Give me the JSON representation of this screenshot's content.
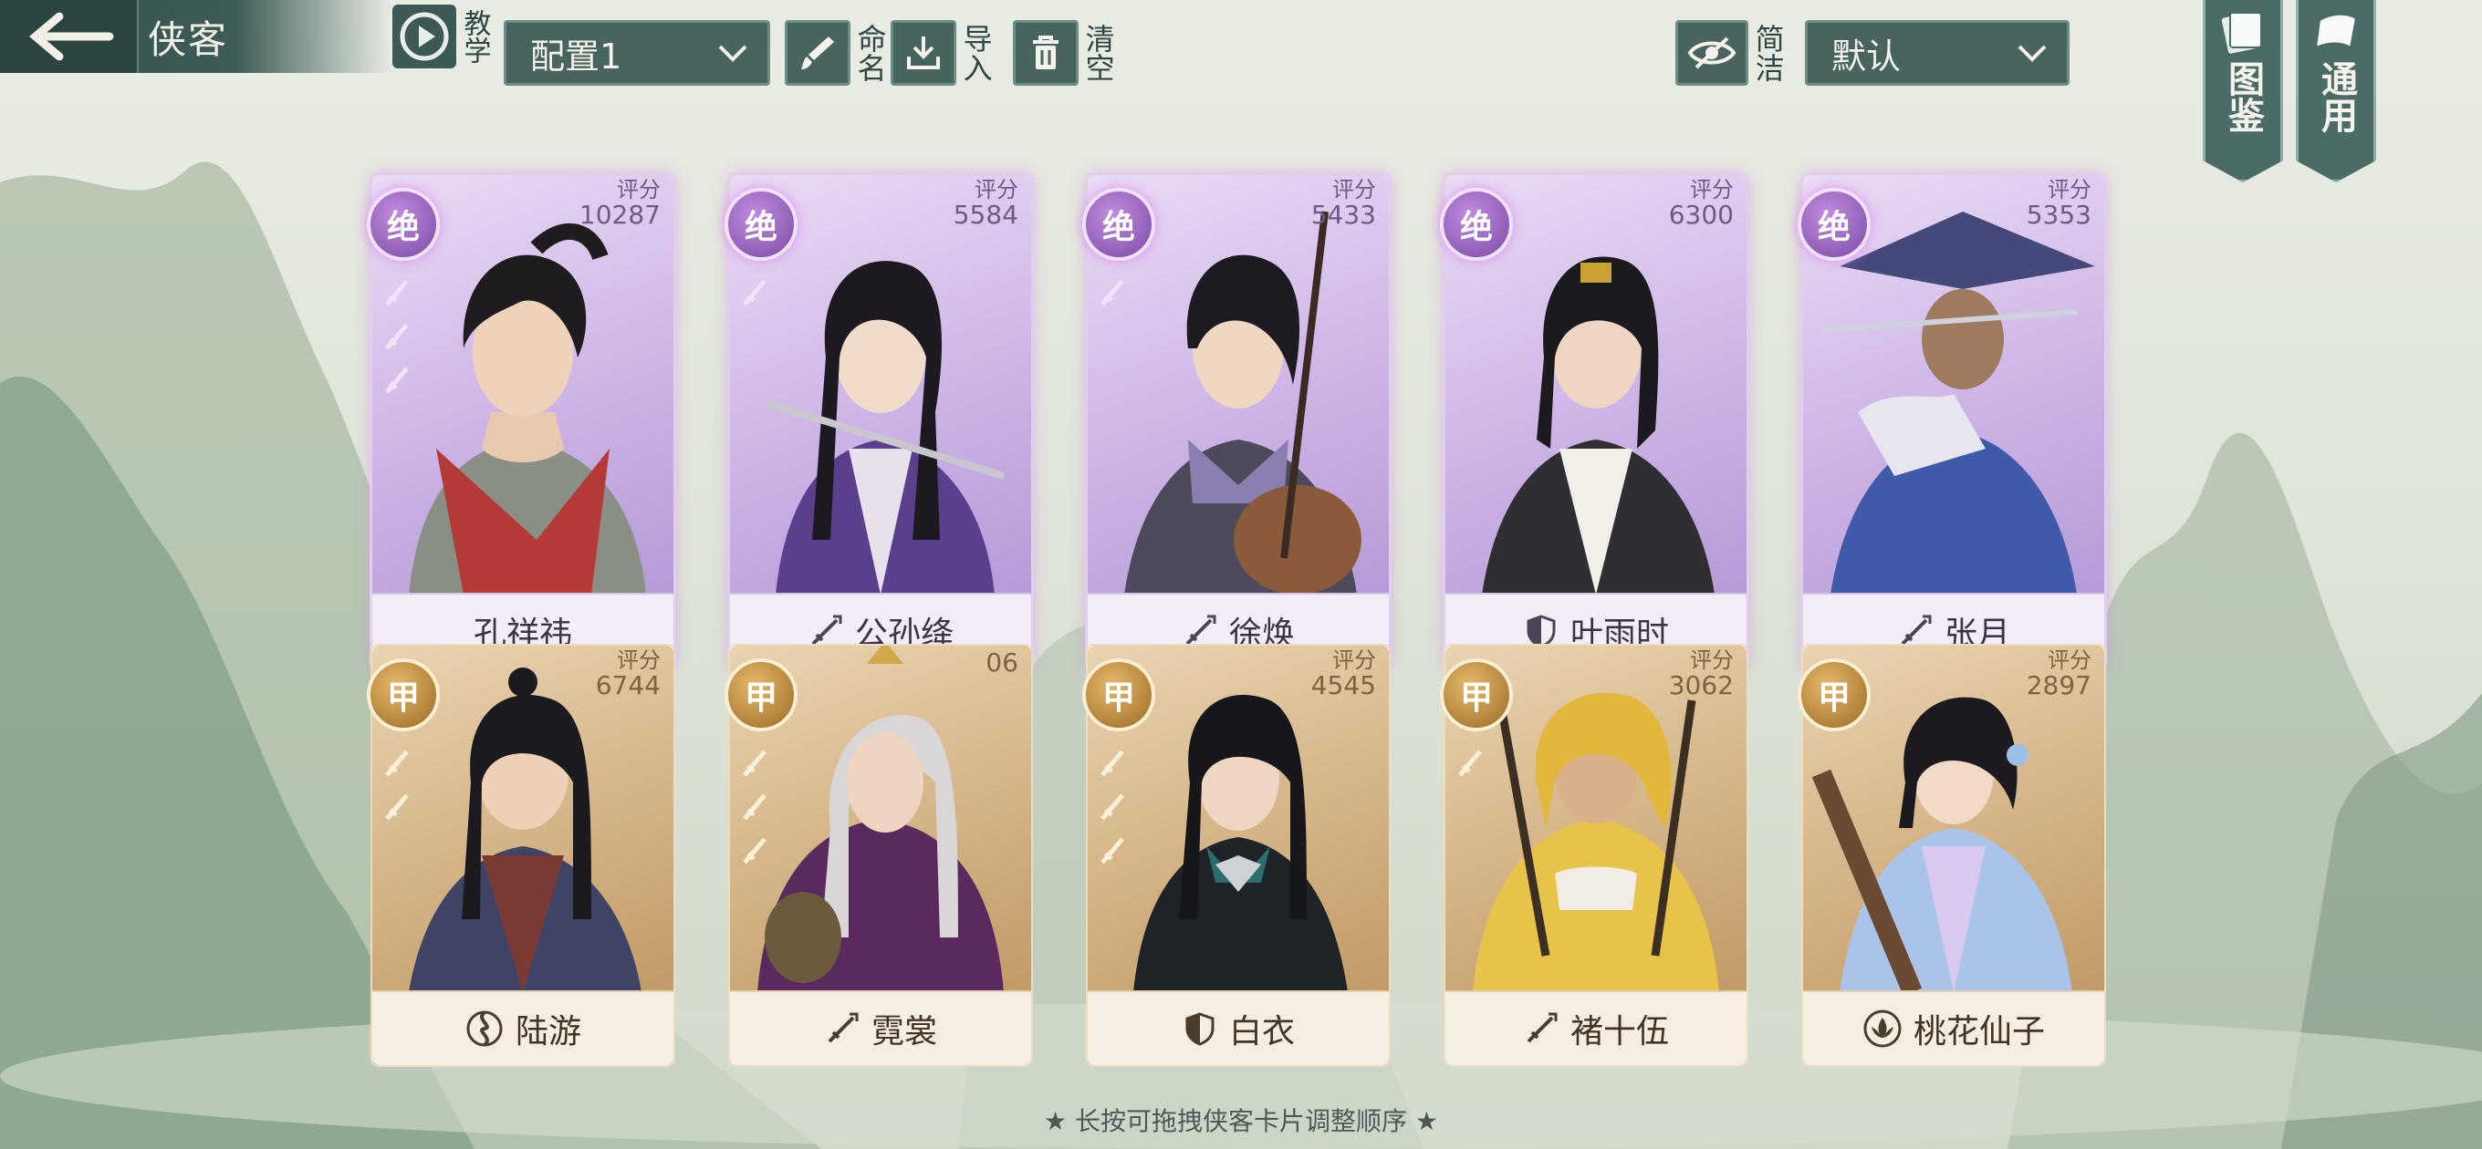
{
  "header": {
    "title": "侠客",
    "tutorial_label": "教学",
    "config_select": "配置1",
    "rename_label": "命名",
    "import_label": "导入",
    "clear_label": "清空",
    "simple_label": "简洁",
    "sort_select": "默认",
    "codex_label": "图鉴",
    "general_label": "通用"
  },
  "score_label": "评分",
  "cards": [
    {
      "grade": "绝",
      "score": "10287",
      "name": "孔祥祎",
      "icon": "none",
      "stars": 3
    },
    {
      "grade": "绝",
      "score": "5584",
      "name": "公孙绛",
      "icon": "sword-icon",
      "stars": 1
    },
    {
      "grade": "绝",
      "score": "5433",
      "name": "徐焕",
      "icon": "sword-icon",
      "stars": 1
    },
    {
      "grade": "绝",
      "score": "6300",
      "name": "叶雨时",
      "icon": "shield-icon",
      "stars": 0
    },
    {
      "grade": "绝",
      "score": "5353",
      "name": "张月",
      "icon": "sword-icon",
      "stars": 0
    },
    {
      "grade": "甲",
      "score": "6744",
      "name": "陆游",
      "icon": "swirl-icon",
      "stars": 2
    },
    {
      "grade": "甲",
      "score": "06",
      "name": "霓裳",
      "icon": "sword-icon",
      "stars": 3
    },
    {
      "grade": "甲",
      "score": "4545",
      "name": "白衣",
      "icon": "shield-icon",
      "stars": 3
    },
    {
      "grade": "甲",
      "score": "3062",
      "name": "褚十伍",
      "icon": "sword-icon",
      "stars": 1
    },
    {
      "grade": "甲",
      "score": "2897",
      "name": "桃花仙子",
      "icon": "lotus-icon",
      "stars": 0
    }
  ],
  "hint": "★ 长按可拖拽侠客卡片调整顺序 ★",
  "colors": {
    "header_bg": "#47645f",
    "purple_card": "#cdb4e6",
    "gold_card": "#d4b386"
  }
}
